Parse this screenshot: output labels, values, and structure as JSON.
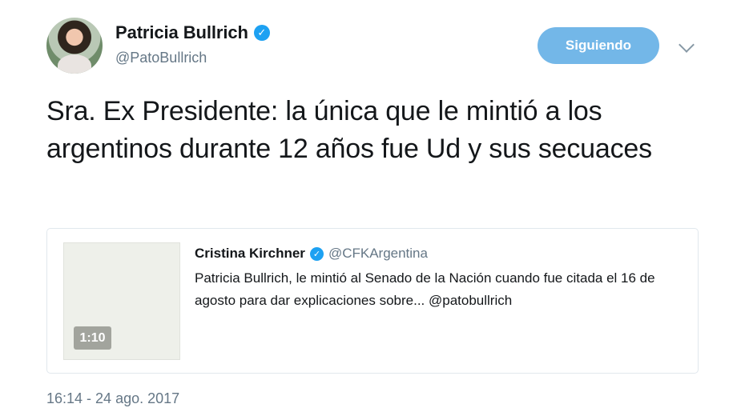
{
  "author": {
    "name": "Patricia Bullrich",
    "handle": "@PatoBullrich",
    "verified_icon": "✓",
    "follow_label": "Siguiendo"
  },
  "tweet": {
    "text": "Sra. Ex Presidente: la única que le mintió a los argentinos durante 12 años fue Ud y sus secuaces",
    "timestamp": "16:14 - 24 ago. 2017"
  },
  "quoted_tweet": {
    "name": "Cristina Kirchner",
    "handle": "@CFKArgentina",
    "verified_icon": "✓",
    "text": "Patricia Bullrich, le mintió al Senado de la Nación cuando fue citada el 16 de agosto para dar explicaciones sobre... @patobullrich",
    "video_duration": "1:10"
  },
  "icons": {
    "dropdown": "chevron-down-icon",
    "verified": "verified-badge-icon"
  },
  "colors": {
    "accent": "#1da1f2",
    "follow_button": "#73b7e8",
    "muted_text": "#657786",
    "border": "#e1e8ed"
  }
}
